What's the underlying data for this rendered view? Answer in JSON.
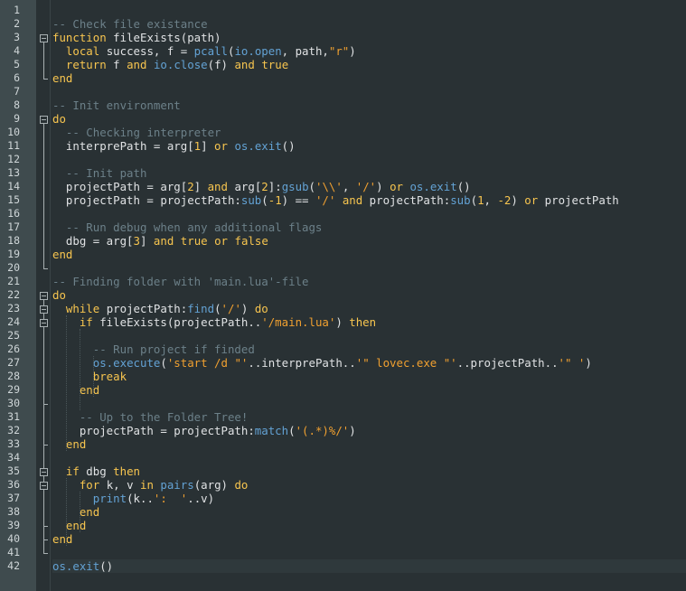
{
  "editor": {
    "language": "lua",
    "current_line": 42,
    "colors": {
      "background": "#293134",
      "gutter": "#3f4b4e",
      "comment": "#6c8089",
      "keyword": "#f7c54f",
      "string": "#f0a030",
      "builtin": "#63a2d4",
      "text": "#e0e2e4"
    },
    "fold_markers": [
      3,
      9,
      22,
      23,
      24,
      35,
      36
    ],
    "lines": [
      [],
      [
        [
          "c",
          "-- Check file existance"
        ]
      ],
      [
        [
          "k",
          "function"
        ],
        [
          "p",
          " fileExists(path)"
        ]
      ],
      [
        [
          "p",
          "  "
        ],
        [
          "k",
          "local"
        ],
        [
          "p",
          " success, f = "
        ],
        [
          "b",
          "pcall"
        ],
        [
          "p",
          "("
        ],
        [
          "b",
          "io.open"
        ],
        [
          "p",
          ", path,"
        ],
        [
          "s",
          "\"r\""
        ],
        [
          "p",
          ")"
        ]
      ],
      [
        [
          "p",
          "  "
        ],
        [
          "k",
          "return"
        ],
        [
          "p",
          " f "
        ],
        [
          "k",
          "and"
        ],
        [
          "p",
          " "
        ],
        [
          "b",
          "io.close"
        ],
        [
          "p",
          "(f) "
        ],
        [
          "k",
          "and"
        ],
        [
          "p",
          " "
        ],
        [
          "k",
          "true"
        ]
      ],
      [
        [
          "k",
          "end"
        ]
      ],
      [],
      [
        [
          "c",
          "-- Init environment"
        ]
      ],
      [
        [
          "k",
          "do"
        ]
      ],
      [
        [
          "p",
          "  "
        ],
        [
          "c",
          "-- Checking interpreter"
        ]
      ],
      [
        [
          "p",
          "  interprePath = arg["
        ],
        [
          "n",
          "1"
        ],
        [
          "p",
          "] "
        ],
        [
          "k",
          "or"
        ],
        [
          "p",
          " "
        ],
        [
          "b",
          "os.exit"
        ],
        [
          "p",
          "()"
        ]
      ],
      [],
      [
        [
          "p",
          "  "
        ],
        [
          "c",
          "-- Init path"
        ]
      ],
      [
        [
          "p",
          "  projectPath = arg["
        ],
        [
          "n",
          "2"
        ],
        [
          "p",
          "] "
        ],
        [
          "k",
          "and"
        ],
        [
          "p",
          " arg["
        ],
        [
          "n",
          "2"
        ],
        [
          "p",
          "]:"
        ],
        [
          "b",
          "gsub"
        ],
        [
          "p",
          "("
        ],
        [
          "s",
          "'\\\\'"
        ],
        [
          "p",
          ", "
        ],
        [
          "s",
          "'/'"
        ],
        [
          "p",
          ") "
        ],
        [
          "k",
          "or"
        ],
        [
          "p",
          " "
        ],
        [
          "b",
          "os.exit"
        ],
        [
          "p",
          "()"
        ]
      ],
      [
        [
          "p",
          "  projectPath = projectPath:"
        ],
        [
          "b",
          "sub"
        ],
        [
          "p",
          "("
        ],
        [
          "n",
          "-1"
        ],
        [
          "p",
          ") == "
        ],
        [
          "s",
          "'/'"
        ],
        [
          "p",
          " "
        ],
        [
          "k",
          "and"
        ],
        [
          "p",
          " projectPath:"
        ],
        [
          "b",
          "sub"
        ],
        [
          "p",
          "("
        ],
        [
          "n",
          "1"
        ],
        [
          "p",
          ", "
        ],
        [
          "n",
          "-2"
        ],
        [
          "p",
          ") "
        ],
        [
          "k",
          "or"
        ],
        [
          "p",
          " projectPath"
        ]
      ],
      [],
      [
        [
          "p",
          "  "
        ],
        [
          "c",
          "-- Run debug when any additional flags"
        ]
      ],
      [
        [
          "p",
          "  dbg = arg["
        ],
        [
          "n",
          "3"
        ],
        [
          "p",
          "] "
        ],
        [
          "k",
          "and"
        ],
        [
          "p",
          " "
        ],
        [
          "k",
          "true"
        ],
        [
          "p",
          " "
        ],
        [
          "k",
          "or"
        ],
        [
          "p",
          " "
        ],
        [
          "k",
          "false"
        ]
      ],
      [
        [
          "k",
          "end"
        ]
      ],
      [],
      [
        [
          "c",
          "-- Finding folder with 'main.lua'-file"
        ]
      ],
      [
        [
          "k",
          "do"
        ]
      ],
      [
        [
          "p",
          "  "
        ],
        [
          "k",
          "while"
        ],
        [
          "p",
          " projectPath:"
        ],
        [
          "b",
          "find"
        ],
        [
          "p",
          "("
        ],
        [
          "s",
          "'/'"
        ],
        [
          "p",
          ") "
        ],
        [
          "k",
          "do"
        ]
      ],
      [
        [
          "p",
          "    "
        ],
        [
          "k",
          "if"
        ],
        [
          "p",
          " fileExists(projectPath.."
        ],
        [
          "s",
          "'/main.lua'"
        ],
        [
          "p",
          ") "
        ],
        [
          "k",
          "then"
        ]
      ],
      [],
      [
        [
          "p",
          "      "
        ],
        [
          "c",
          "-- Run project if finded"
        ]
      ],
      [
        [
          "p",
          "      "
        ],
        [
          "b",
          "os.execute"
        ],
        [
          "p",
          "("
        ],
        [
          "s",
          "'start /d \"'"
        ],
        [
          "p",
          "..interprePath.."
        ],
        [
          "s",
          "'\" lovec.exe \"'"
        ],
        [
          "p",
          "..projectPath.."
        ],
        [
          "s",
          "'\" '"
        ],
        [
          "p",
          ")"
        ]
      ],
      [
        [
          "p",
          "      "
        ],
        [
          "k",
          "break"
        ]
      ],
      [
        [
          "p",
          "    "
        ],
        [
          "k",
          "end"
        ]
      ],
      [],
      [
        [
          "p",
          "    "
        ],
        [
          "c",
          "-- Up to the Folder Tree!"
        ]
      ],
      [
        [
          "p",
          "    projectPath = projectPath:"
        ],
        [
          "b",
          "match"
        ],
        [
          "p",
          "("
        ],
        [
          "s",
          "'(.*)%/'"
        ],
        [
          "p",
          ")"
        ]
      ],
      [
        [
          "p",
          "  "
        ],
        [
          "k",
          "end"
        ]
      ],
      [],
      [
        [
          "p",
          "  "
        ],
        [
          "k",
          "if"
        ],
        [
          "p",
          " dbg "
        ],
        [
          "k",
          "then"
        ]
      ],
      [
        [
          "p",
          "    "
        ],
        [
          "k",
          "for"
        ],
        [
          "p",
          " k, v "
        ],
        [
          "k",
          "in"
        ],
        [
          "p",
          " "
        ],
        [
          "b",
          "pairs"
        ],
        [
          "p",
          "(arg) "
        ],
        [
          "k",
          "do"
        ]
      ],
      [
        [
          "p",
          "      "
        ],
        [
          "b",
          "print"
        ],
        [
          "p",
          "(k.."
        ],
        [
          "s",
          "':  '"
        ],
        [
          "p",
          "..v)"
        ]
      ],
      [
        [
          "p",
          "    "
        ],
        [
          "k",
          "end"
        ]
      ],
      [
        [
          "p",
          "  "
        ],
        [
          "k",
          "end"
        ]
      ],
      [
        [
          "k",
          "end"
        ]
      ],
      [],
      [
        [
          "b",
          "os.exit"
        ],
        [
          "p",
          "()"
        ]
      ]
    ]
  }
}
